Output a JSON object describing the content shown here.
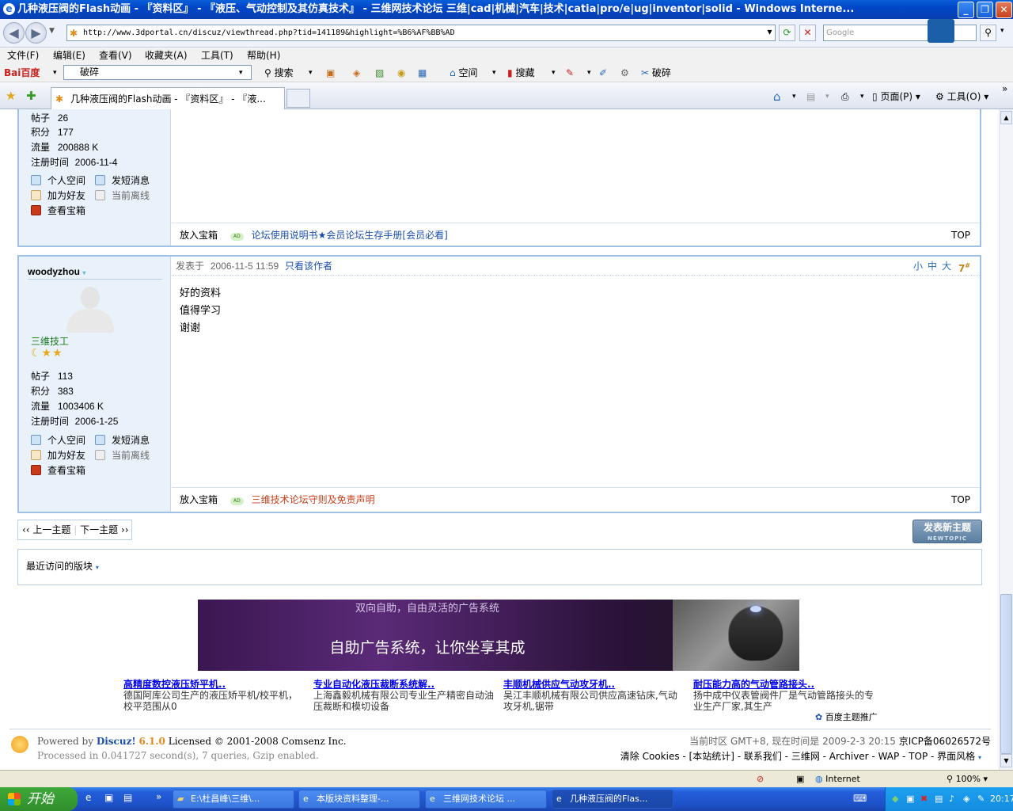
{
  "window": {
    "title": "几种液压阀的Flash动画 - 『资料区』 - 『液压、气动控制及其仿真技术』 - 三维网技术论坛 三维|cad|机械|汽车|技术|catia|pro/e|ug|inventor|solid - Windows Interne..."
  },
  "address": {
    "url": "http://www.3dportal.cn/discuz/viewthread.php?tid=141189&highlight=%B6%AF%BB%AD",
    "search_placeholder": "Google"
  },
  "menu": [
    "文件(F)",
    "编辑(E)",
    "查看(V)",
    "收藏夹(A)",
    "工具(T)",
    "帮助(H)"
  ],
  "baidu": {
    "logo": "Bai百度",
    "query": "破碎",
    "search": "搜索",
    "space": "空间",
    "collect": "搜藏",
    "last": "破碎"
  },
  "tabs": {
    "active": "几种液压阀的Flash动画 - 『资料区』 - 『液...",
    "page": "页面(P)",
    "tools": "工具(O)"
  },
  "post_top": {
    "stats": [
      {
        "k": "帖子",
        "v": "26"
      },
      {
        "k": "积分",
        "v": "177"
      },
      {
        "k": "流量",
        "v": "200888 K"
      },
      {
        "k": "注册时间",
        "v": "2006-11-4"
      }
    ],
    "actions": [
      "个人空间",
      "发短消息",
      "加为好友",
      "当前离线",
      "查看宝箱"
    ],
    "footer": {
      "box": "放入宝箱",
      "ad": "论坛使用说明书★会员论坛生存手册[会员必看]",
      "top": "TOP"
    }
  },
  "post_main": {
    "author": "woodyzhou",
    "rank": "三维技工",
    "posted_label": "发表于",
    "posted_time": "2006-11-5 11:59",
    "only_author": "只看该作者",
    "font_sizes": [
      "小",
      "中",
      "大"
    ],
    "floor": "7",
    "floor_mark": "#",
    "content": [
      "好的资料",
      "值得学习",
      "谢谢"
    ],
    "stats": [
      {
        "k": "帖子",
        "v": "113"
      },
      {
        "k": "积分",
        "v": "383"
      },
      {
        "k": "流量",
        "v": "1003406 K"
      },
      {
        "k": "注册时间",
        "v": "2006-1-25"
      }
    ],
    "actions": [
      "个人空间",
      "发短消息",
      "加为好友",
      "当前离线",
      "查看宝箱"
    ],
    "footer": {
      "box": "放入宝箱",
      "ad": "三维技术论坛守则及免责声明",
      "top": "TOP"
    }
  },
  "pager": {
    "prev": "上一主题",
    "next": "下一主题",
    "new_topic": "发表新主题",
    "new_topic_sub": "NEWTOPIC"
  },
  "recent": {
    "label": "最近访问的版块"
  },
  "ad_banner": {
    "line1": "双向自助，自由灵活的广告系统",
    "line2": "自助广告系统，让你坐享其成"
  },
  "ad_links": [
    {
      "title": "高精度数控液压矫平机..",
      "desc": "德国阿库公司生产的液压矫平机/校平机，校平范围从0"
    },
    {
      "title": "专业自动化液压裁断系统解..",
      "desc": "上海鑫毅机械有限公司专业生产精密自动油压裁断和模切设备"
    },
    {
      "title": "丰顺机械供应气动攻牙机..",
      "desc": "吴江丰顺机械有限公司供应高速钻床,气动攻牙机,锯带"
    },
    {
      "title": "耐压能力高的气动管路接头..",
      "desc": "扬中成中仪表管阀件厂是气动管路接头的专业生产厂家,其生产"
    }
  ],
  "baidu_promo": "百度主题推广",
  "footer": {
    "powered": "Powered by",
    "product": "Discuz!",
    "version": "6.1.0",
    "license": "Licensed © 2001-2008 Comsenz Inc.",
    "processed": "Processed in 0.041727 second(s), 7 queries, Gzip enabled.",
    "tz": "当前时区  GMT+8, 现在时间是  2009-2-3 20:15",
    "icp": "京ICP备06026572号",
    "links": "清除 Cookies - [本站统计] - 联系我们 - 三维网 - Archiver - WAP - TOP - 界面风格"
  },
  "status": {
    "zone": "Internet",
    "zoom": "100%"
  },
  "taskbar": {
    "start": "开始",
    "items": [
      "E:\\杜昌峰\\三维\\...",
      "本版块资料整理-...",
      "三维网技术论坛 ...",
      "几种液压阀的Flas..."
    ],
    "clock": "20:17"
  }
}
